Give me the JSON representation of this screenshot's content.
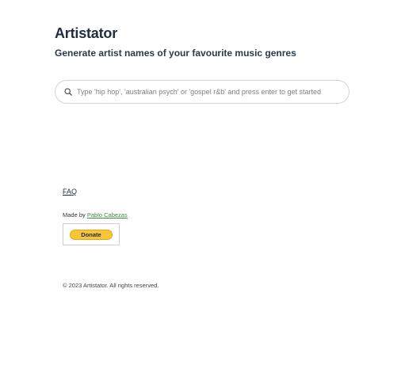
{
  "header": {
    "title": "Artistator",
    "subtitle": "Generate artist names of your favourite music genres"
  },
  "search": {
    "icon": "search-icon",
    "placeholder": "Type 'hip hop', 'australian psych' or 'gospel r&b' and press enter to get started",
    "value": ""
  },
  "footer": {
    "faq_label": "FAQ",
    "made_by_prefix": "Made by ",
    "author_name": "Pablo Cabezas",
    "donate_label": "Donate",
    "copyright": "© 2023 Artistator. All rights reserved."
  },
  "colors": {
    "title": "#1f2d3d",
    "author_link": "#3a8a3a",
    "donate_button": "#f8c53a"
  }
}
